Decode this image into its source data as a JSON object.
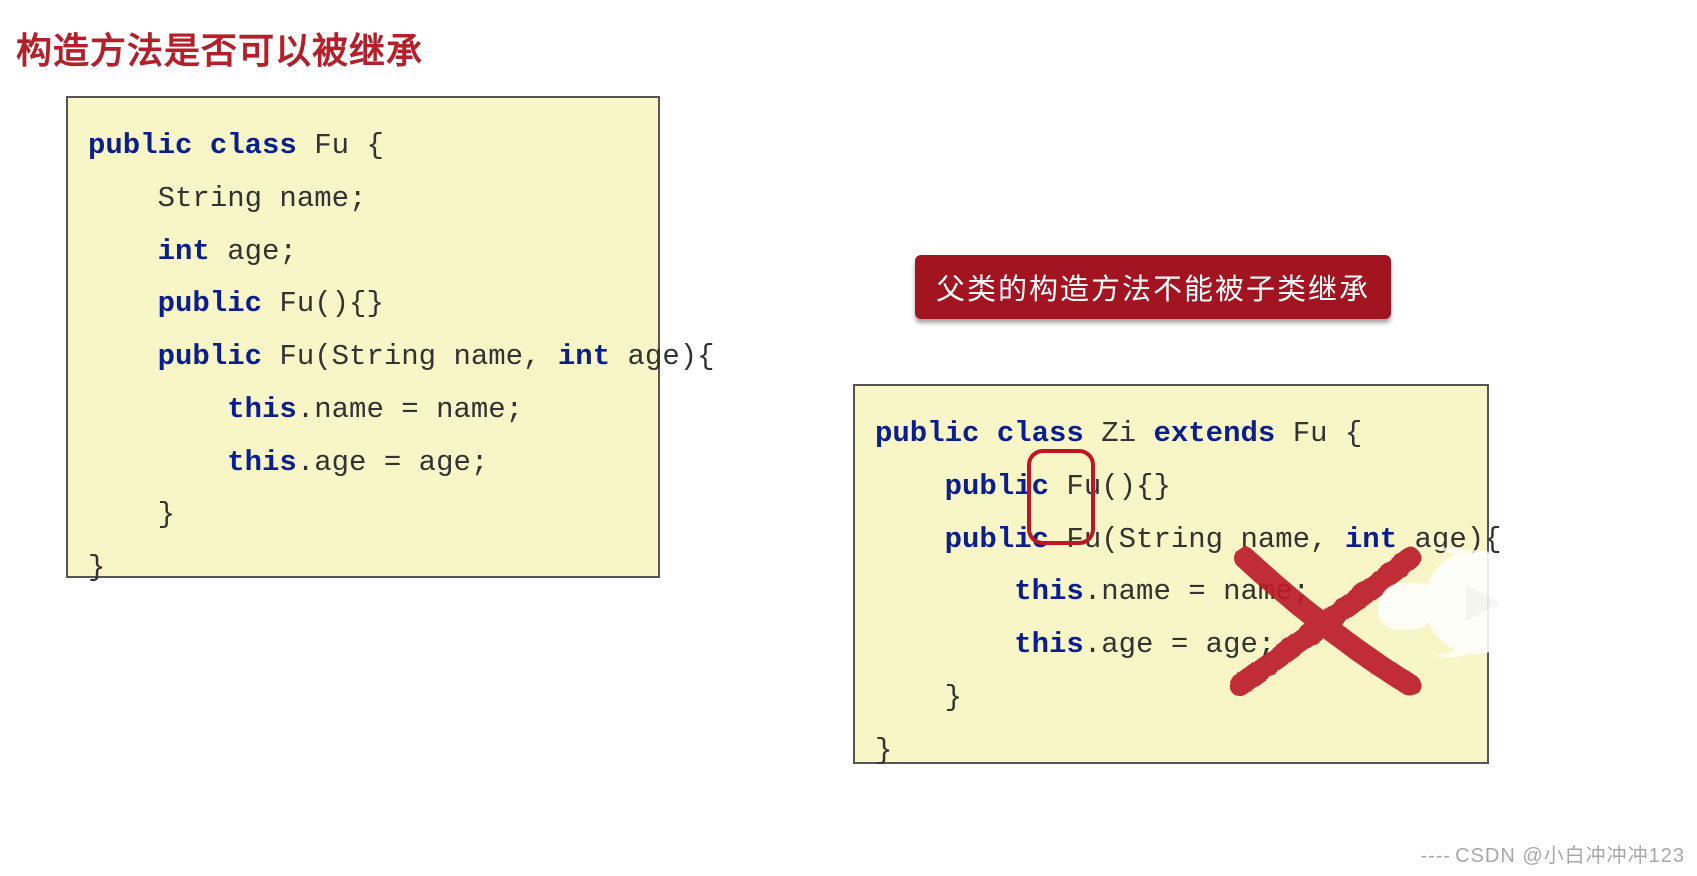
{
  "title": "构造方法是否可以被继承",
  "banner": "父类的构造方法不能被子类继承",
  "code_left": {
    "l1a": "public",
    "l1b": " class",
    "l1c": " Fu {",
    "l2a": "    String name;",
    "l3a": "    int",
    "l3b": " age;",
    "l4a": "    public",
    "l4b": " Fu(){}",
    "l5a": "    public",
    "l5b": " Fu(String name, ",
    "l5c": "int",
    "l5d": " age){",
    "l6a": "        this",
    "l6b": ".name = name;",
    "l7a": "        this",
    "l7b": ".age = age;",
    "l8a": "    }",
    "l9a": "}"
  },
  "code_right": {
    "l1a": "public",
    "l1b": " class",
    "l1c": " Zi ",
    "l1d": "extends",
    "l1e": " Fu {",
    "l2a": "    public",
    "l2b": " Fu(){}",
    "l3a": "    public",
    "l3b": " Fu(String name, ",
    "l3c": "int",
    "l3d": " age){",
    "l4a": "        this",
    "l4b": ".name = name;",
    "l5a": "        this",
    "l5b": ".age = age;",
    "l6a": "    }",
    "l7a": "}"
  },
  "watermark_prefix": "----",
  "watermark": "CSDN @小白冲冲冲123",
  "colors": {
    "title": "#b3202a",
    "banner_bg": "#a21420",
    "code_bg": "#f8f6c7",
    "keyword": "#0a1f8f",
    "highlight_border": "#c01525",
    "cross": "#bd1d2c"
  },
  "icons": {
    "highlight_box": "rounded-rectangle-highlight",
    "cross_mark": "brush-x-mark",
    "play_button": "play-circle-icon"
  }
}
